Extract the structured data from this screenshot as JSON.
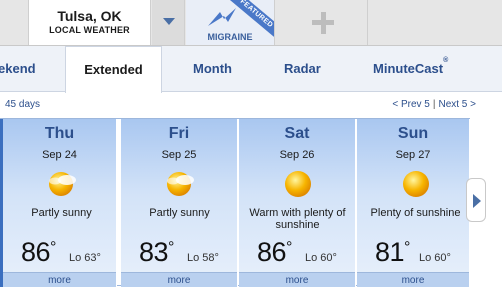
{
  "location": {
    "city": "Tulsa, OK",
    "subtitle": "LOCAL WEATHER"
  },
  "featured": {
    "label": "MIGRAINE",
    "badge": "FEATURED"
  },
  "tabs": [
    {
      "label": "ekend"
    },
    {
      "label": "Extended"
    },
    {
      "label": "Month"
    },
    {
      "label": "Radar"
    },
    {
      "label": "MinuteCast",
      "mark": "®"
    }
  ],
  "range": {
    "label": "45 days"
  },
  "pager": {
    "prev": "< Prev 5",
    "next": "Next 5 >"
  },
  "forecast": [
    {
      "day": "Thu",
      "date": "Sep 24",
      "condition": "Partly sunny",
      "icon": "partly-sunny-icon",
      "high": "86",
      "low": "Lo 63°",
      "more": "more"
    },
    {
      "day": "Fri",
      "date": "Sep 25",
      "condition": "Partly sunny",
      "icon": "partly-sunny-icon",
      "high": "83",
      "low": "Lo 58°",
      "more": "more"
    },
    {
      "day": "Sat",
      "date": "Sep 26",
      "condition": "Warm with plenty of sunshine",
      "icon": "sunny-icon",
      "high": "86",
      "low": "Lo 60°",
      "more": "more"
    },
    {
      "day": "Sun",
      "date": "Sep 27",
      "condition": "Plenty of sunshine",
      "icon": "sunny-icon",
      "high": "81",
      "low": "Lo 60°",
      "more": "more"
    }
  ],
  "deg": "°",
  "colors": {
    "accent": "#2c4f8c",
    "sun": "#f7b500",
    "panel_top": "#a9c7f0"
  }
}
